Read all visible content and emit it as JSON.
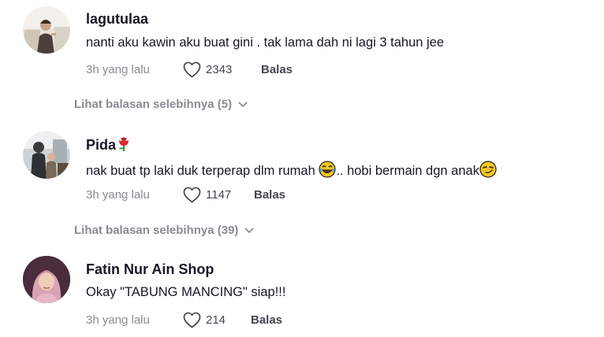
{
  "comments": [
    {
      "username": "lagutulaa",
      "text": "nanti aku kawin aku buat gini . tak lama dah ni lagi 3 tahun jee",
      "time": "3h yang lalu",
      "likes": "2343",
      "reply_label": "Balas",
      "view_more": "Lihat balasan selebihnya (5)"
    },
    {
      "username": "Pida",
      "username_icon": "rose-emoji",
      "text_part1": "nak buat tp laki duk terperap dlm rumah ",
      "text_emoji1": "laughing-tears-emoji",
      "text_part2": ".. hobi bermain dgn anak",
      "text_emoji2": "smirk-emoji",
      "time": "3h yang lalu",
      "likes": "1147",
      "reply_label": "Balas",
      "view_more": "Lihat balasan selebihnya (39)"
    },
    {
      "username": "Fatin Nur Ain Shop",
      "text": "Okay \"TABUNG MANCING\" siap!!!",
      "time": "3h yang lalu",
      "likes": "214",
      "reply_label": "Balas"
    }
  ]
}
